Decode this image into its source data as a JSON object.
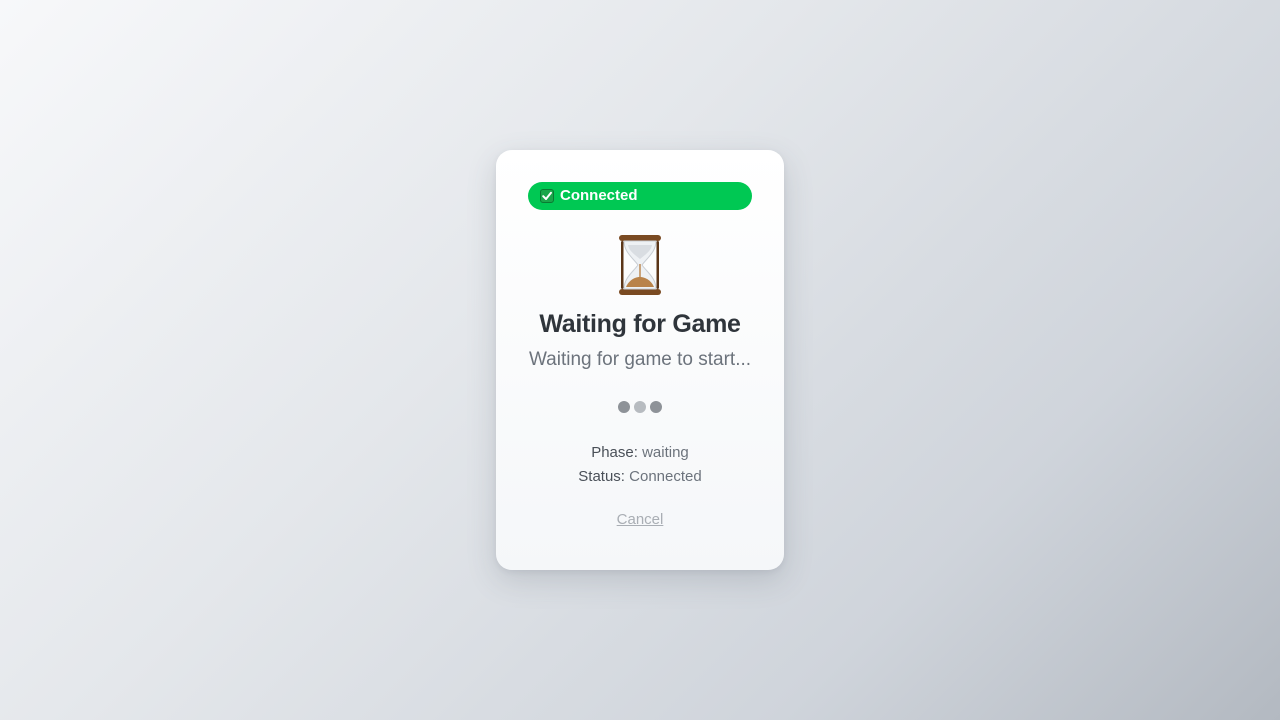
{
  "card": {
    "status_pill": {
      "icon": "check-box-icon",
      "label": "Connected",
      "color": "#00c853"
    },
    "hourglass_icon": "hourglass-icon",
    "title": "Waiting for Game",
    "subtitle": "Waiting for game to start...",
    "loading_dots": 3,
    "info": {
      "phase_label": "Phase:",
      "phase_value": "waiting",
      "status_label": "Status:",
      "status_value": "Connected"
    },
    "cancel_label": "Cancel"
  }
}
